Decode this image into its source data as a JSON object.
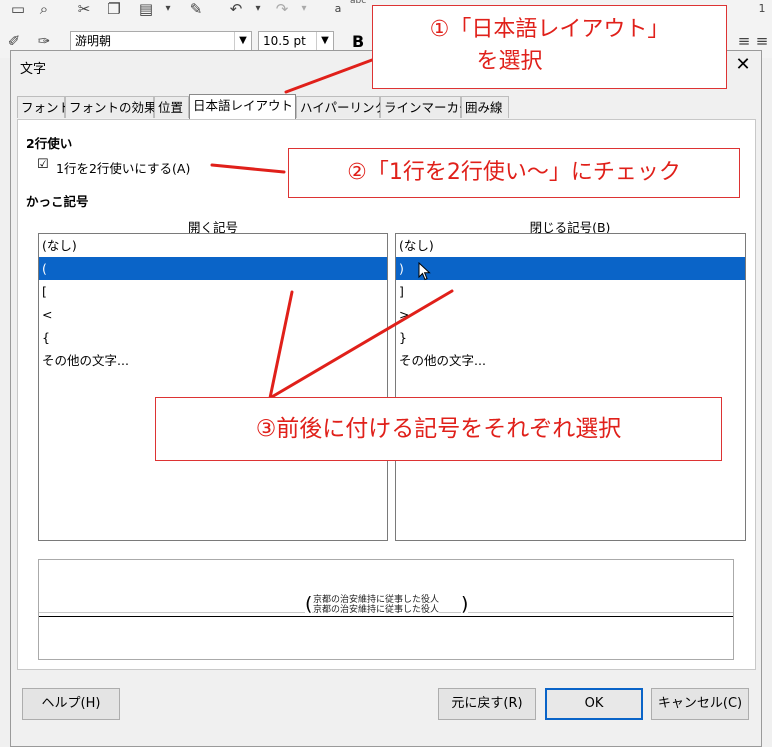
{
  "toolbar": {
    "font_name": "游明朝",
    "font_size": "10.5 pt",
    "bold_label": "B",
    "abc_label": "abc"
  },
  "dialog": {
    "title": "文字",
    "close_symbol": "✕",
    "tabs": [
      {
        "label": "フォント"
      },
      {
        "label": "フォントの効果"
      },
      {
        "label": "位置"
      },
      {
        "label": "日本語レイアウト"
      },
      {
        "label": "ハイパーリンク"
      },
      {
        "label": "ラインマーカー"
      },
      {
        "label": "囲み線"
      }
    ],
    "two_line": {
      "heading": "2行使い",
      "checkbox_label": "1行を2行使いにする(A)",
      "checked": true
    },
    "brackets": {
      "heading": "かっこ記号",
      "open_label": "開く記号",
      "close_label": "閉じる記号(B)",
      "open_items": [
        "(なし)",
        "(",
        "[",
        "<",
        "{",
        "その他の文字..."
      ],
      "close_items": [
        "(なし)",
        ")",
        "]",
        ">",
        "}",
        "その他の文字..."
      ],
      "open_selected_index": 1,
      "close_selected_index": 1
    },
    "preview": {
      "open_bracket": "(",
      "close_bracket": ")",
      "line1": "京都の治安維持に従事した役人",
      "line2": "京都の治安維持に従事した役人"
    },
    "buttons": {
      "help": "ヘルプ(H)",
      "reset": "元に戻す(R)",
      "ok": "OK",
      "cancel": "キャンセル(C)"
    }
  },
  "annotations": {
    "step1_line1": "①「日本語レイアウト」",
    "step1_line2": "を選択",
    "step2": "②「1行を2行使い～」にチェック",
    "step3": "③前後に付ける記号をそれぞれ選択",
    "color": "#e0201a"
  }
}
